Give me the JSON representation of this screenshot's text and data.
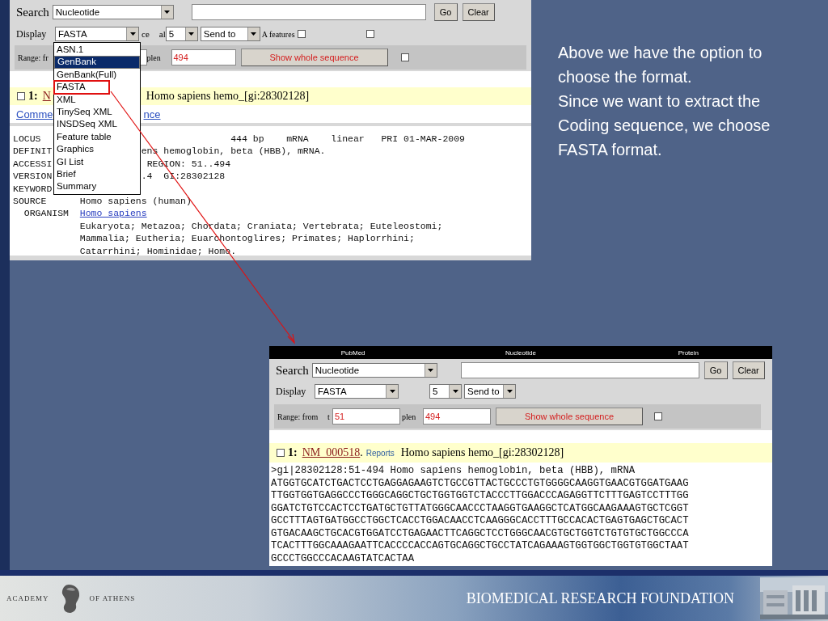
{
  "top_screenshot": {
    "search": {
      "label": "Search",
      "database": "Nucleotide",
      "buttons": [
        "Go",
        "Clear"
      ]
    },
    "display": {
      "label": "Display",
      "format": "FASTA",
      "fragment_1": "ce",
      "fragment_2": "al",
      "per_page": "5",
      "send_to": "Send to",
      "features_label": "A features",
      "features_checked": false,
      "extra_checked": false
    },
    "range": {
      "label": "Range: fr",
      "fragment": "plen",
      "to": "494",
      "button": "Show whole sequence",
      "checked": false
    },
    "record_header": {
      "checked": false,
      "number": "1:",
      "link": "N",
      "title": "Homo sapiens hemo_[gi:28302128]"
    },
    "links": [
      "Comme",
      "nce"
    ],
    "record_lines": [
      {
        "kind": "covered",
        "left": "LOCUS",
        "right": "444 bp    mRNA    linear   PRI 01-MAR-2009"
      },
      {
        "kind": "covered",
        "left": "DEFINIT",
        "right": "ens hemoglobin, beta (HBB), mRNA."
      },
      {
        "kind": "covered",
        "left": "ACCESSI",
        "right": "REGION: 51..494"
      },
      {
        "kind": "covered",
        "left": "VERSION",
        "right": ".4  GI:28302128"
      },
      {
        "kind": "covered",
        "left": "KEYWORD"
      },
      {
        "kind": "field",
        "left": "SOURCE",
        "right": "Homo sapiens (human)"
      },
      {
        "kind": "link",
        "left": "ORGANISM",
        "right": "Homo sapiens"
      },
      {
        "kind": "cont",
        "right": "Eukaryota; Metazoa; Chordata; Craniata; Vertebrata; Euteleostomi;"
      },
      {
        "kind": "cont",
        "right": "Mammalia; Eutheria; Euarchontoglires; Primates; Haplorrhini;"
      },
      {
        "kind": "cont",
        "right": "Catarrhini; Hominidae; Homo."
      }
    ],
    "format_menu": [
      {
        "label": "ASN.1",
        "selected": false,
        "boxed": false
      },
      {
        "label": "GenBank",
        "selected": true,
        "boxed": false
      },
      {
        "label": "GenBank(Full)",
        "selected": false,
        "boxed": false
      },
      {
        "label": "FASTA",
        "selected": false,
        "boxed": true
      },
      {
        "label": "XML",
        "selected": false,
        "boxed": false
      },
      {
        "label": "TinySeq XML",
        "selected": false,
        "boxed": false
      },
      {
        "label": "INSDSeq XML",
        "selected": false,
        "boxed": false
      },
      {
        "label": "Feature table",
        "selected": false,
        "boxed": false
      },
      {
        "label": "Graphics",
        "selected": false,
        "boxed": false
      },
      {
        "label": "GI List",
        "selected": false,
        "boxed": false
      },
      {
        "label": "Brief",
        "selected": false,
        "boxed": false
      },
      {
        "label": "Summary",
        "selected": false,
        "boxed": false
      }
    ]
  },
  "callout_text": [
    "Above we have the option to choose the format.",
    "Since we want to extract the Coding sequence, we choose FASTA format."
  ],
  "bottom_screenshot": {
    "nav_tabs": [
      "PubMed",
      "Nucleotide",
      "Protein"
    ],
    "search": {
      "label": "Search",
      "database": "Nucleotide",
      "buttons": [
        "Go",
        "Clear"
      ]
    },
    "display": {
      "label": "Display",
      "format": "FASTA",
      "per_page": "5",
      "send_to": "Send to"
    },
    "range": {
      "label": "Range: from",
      "fragment_1": "t",
      "from": "51",
      "fragment_2": "plen",
      "to": "494",
      "button": "Show whole sequence",
      "checked": false
    },
    "record_header": {
      "checked": false,
      "number": "1:",
      "accession": "NM_000518",
      "separator": ".",
      "reports": "Reports",
      "title": "Homo sapiens hemo_[gi:28302128]"
    },
    "fasta_lines": [
      ">gi|28302128:51-494 Homo sapiens hemoglobin, beta (HBB), mRNA",
      "ATGGTGCATCTGACTCCTGAGGAGAAGTCTGCCGTTACTGCCCTGTGGGGCAAGGTGAACGTGGATGAAG",
      "TTGGTGGTGAGGCCCTGGGCAGGCTGCTGGTGGTCTACCCTTGGACCCAGAGGTTCTTTGAGTCCTTTGG",
      "GGATCTGTCCACTCCTGATGCTGTTATGGGCAACCCTAAGGTGAAGGCTCATGGCAAGAAAGTGCTCGGT",
      "GCCTTTAGTGATGGCCTGGCTCACCTGGACAACCTCAAGGGCACCTTTGCCACACTGAGTGAGCTGCACT",
      "GTGACAAGCTGCACGTGGATCCTGAGAACTTCAGGCTCCTGGGCAACGTGCTGGTCTGTGTGCTGGCCCA",
      "TCACTTTGGCAAAGAATTCACCCCACCAGTGCAGGCTGCCTATCAGAAAGTGGTGGCTGGTGTGGCTAAT",
      "GCCCTGGCCCACAAGTATCACTAA"
    ]
  },
  "footer": {
    "left_1": "ACADEMY",
    "left_2": "OF ATHENS",
    "right": "BIOMEDICAL RESEARCH FOUNDATION"
  }
}
